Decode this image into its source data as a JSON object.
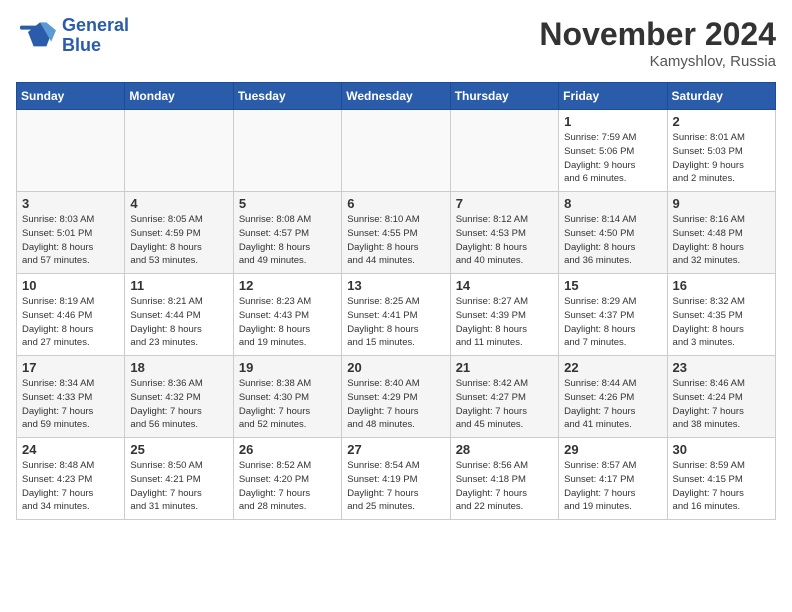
{
  "header": {
    "logo_line1": "General",
    "logo_line2": "Blue",
    "month": "November 2024",
    "location": "Kamyshlov, Russia"
  },
  "days_of_week": [
    "Sunday",
    "Monday",
    "Tuesday",
    "Wednesday",
    "Thursday",
    "Friday",
    "Saturday"
  ],
  "weeks": [
    [
      {
        "num": "",
        "info": ""
      },
      {
        "num": "",
        "info": ""
      },
      {
        "num": "",
        "info": ""
      },
      {
        "num": "",
        "info": ""
      },
      {
        "num": "",
        "info": ""
      },
      {
        "num": "1",
        "info": "Sunrise: 7:59 AM\nSunset: 5:06 PM\nDaylight: 9 hours\nand 6 minutes."
      },
      {
        "num": "2",
        "info": "Sunrise: 8:01 AM\nSunset: 5:03 PM\nDaylight: 9 hours\nand 2 minutes."
      }
    ],
    [
      {
        "num": "3",
        "info": "Sunrise: 8:03 AM\nSunset: 5:01 PM\nDaylight: 8 hours\nand 57 minutes."
      },
      {
        "num": "4",
        "info": "Sunrise: 8:05 AM\nSunset: 4:59 PM\nDaylight: 8 hours\nand 53 minutes."
      },
      {
        "num": "5",
        "info": "Sunrise: 8:08 AM\nSunset: 4:57 PM\nDaylight: 8 hours\nand 49 minutes."
      },
      {
        "num": "6",
        "info": "Sunrise: 8:10 AM\nSunset: 4:55 PM\nDaylight: 8 hours\nand 44 minutes."
      },
      {
        "num": "7",
        "info": "Sunrise: 8:12 AM\nSunset: 4:53 PM\nDaylight: 8 hours\nand 40 minutes."
      },
      {
        "num": "8",
        "info": "Sunrise: 8:14 AM\nSunset: 4:50 PM\nDaylight: 8 hours\nand 36 minutes."
      },
      {
        "num": "9",
        "info": "Sunrise: 8:16 AM\nSunset: 4:48 PM\nDaylight: 8 hours\nand 32 minutes."
      }
    ],
    [
      {
        "num": "10",
        "info": "Sunrise: 8:19 AM\nSunset: 4:46 PM\nDaylight: 8 hours\nand 27 minutes."
      },
      {
        "num": "11",
        "info": "Sunrise: 8:21 AM\nSunset: 4:44 PM\nDaylight: 8 hours\nand 23 minutes."
      },
      {
        "num": "12",
        "info": "Sunrise: 8:23 AM\nSunset: 4:43 PM\nDaylight: 8 hours\nand 19 minutes."
      },
      {
        "num": "13",
        "info": "Sunrise: 8:25 AM\nSunset: 4:41 PM\nDaylight: 8 hours\nand 15 minutes."
      },
      {
        "num": "14",
        "info": "Sunrise: 8:27 AM\nSunset: 4:39 PM\nDaylight: 8 hours\nand 11 minutes."
      },
      {
        "num": "15",
        "info": "Sunrise: 8:29 AM\nSunset: 4:37 PM\nDaylight: 8 hours\nand 7 minutes."
      },
      {
        "num": "16",
        "info": "Sunrise: 8:32 AM\nSunset: 4:35 PM\nDaylight: 8 hours\nand 3 minutes."
      }
    ],
    [
      {
        "num": "17",
        "info": "Sunrise: 8:34 AM\nSunset: 4:33 PM\nDaylight: 7 hours\nand 59 minutes."
      },
      {
        "num": "18",
        "info": "Sunrise: 8:36 AM\nSunset: 4:32 PM\nDaylight: 7 hours\nand 56 minutes."
      },
      {
        "num": "19",
        "info": "Sunrise: 8:38 AM\nSunset: 4:30 PM\nDaylight: 7 hours\nand 52 minutes."
      },
      {
        "num": "20",
        "info": "Sunrise: 8:40 AM\nSunset: 4:29 PM\nDaylight: 7 hours\nand 48 minutes."
      },
      {
        "num": "21",
        "info": "Sunrise: 8:42 AM\nSunset: 4:27 PM\nDaylight: 7 hours\nand 45 minutes."
      },
      {
        "num": "22",
        "info": "Sunrise: 8:44 AM\nSunset: 4:26 PM\nDaylight: 7 hours\nand 41 minutes."
      },
      {
        "num": "23",
        "info": "Sunrise: 8:46 AM\nSunset: 4:24 PM\nDaylight: 7 hours\nand 38 minutes."
      }
    ],
    [
      {
        "num": "24",
        "info": "Sunrise: 8:48 AM\nSunset: 4:23 PM\nDaylight: 7 hours\nand 34 minutes."
      },
      {
        "num": "25",
        "info": "Sunrise: 8:50 AM\nSunset: 4:21 PM\nDaylight: 7 hours\nand 31 minutes."
      },
      {
        "num": "26",
        "info": "Sunrise: 8:52 AM\nSunset: 4:20 PM\nDaylight: 7 hours\nand 28 minutes."
      },
      {
        "num": "27",
        "info": "Sunrise: 8:54 AM\nSunset: 4:19 PM\nDaylight: 7 hours\nand 25 minutes."
      },
      {
        "num": "28",
        "info": "Sunrise: 8:56 AM\nSunset: 4:18 PM\nDaylight: 7 hours\nand 22 minutes."
      },
      {
        "num": "29",
        "info": "Sunrise: 8:57 AM\nSunset: 4:17 PM\nDaylight: 7 hours\nand 19 minutes."
      },
      {
        "num": "30",
        "info": "Sunrise: 8:59 AM\nSunset: 4:15 PM\nDaylight: 7 hours\nand 16 minutes."
      }
    ]
  ]
}
